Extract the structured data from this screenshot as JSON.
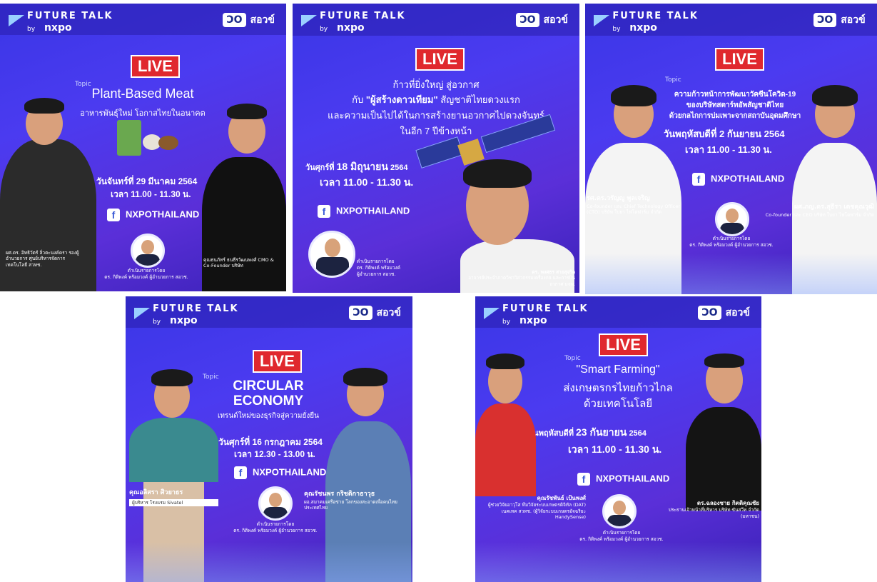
{
  "brand": {
    "future_talk": "FUTURE TALK",
    "by": "by",
    "nxpo": "nxpo",
    "logo_a": "ƆO",
    "logo_b": "สอวข์"
  },
  "colors": {
    "live_red": "#e0282e",
    "poster_blue": "#4b3bf0"
  },
  "posters": [
    {
      "live": "LIVE",
      "topic": "Topic",
      "title_en": "Plant-Based Meat",
      "title_th": "อาหารพันธุ์ใหม่ โอกาสไทยในอนาคต",
      "date": "วันจันทร์ที่ 29 มีนาคม 2564",
      "time": "เวลา 11.00 - 11.30 น.",
      "facebook": "NXPOTHAILAND",
      "host_line1": "ดำเนินรายการโดย",
      "host_line2": "ดร. กิติพงค์ พร้อมวงค์ ผู้อำนวยการ สอวช.",
      "guest_left": "ผศ.ดร. อิทธิวัตร์ ลิ่วตะนงค์ครา รองผู้อำนวยการ ศูนย์บริหารจัดการเทคโนโลยี สวทช.",
      "guest_right": "คุณธนภัทร์ ธนธีรวัฒนพงศ์ CMO & Co-Founder บริษัท"
    },
    {
      "live": "LIVE",
      "title_line1": "ก้าวที่ยิ่งใหญ่ สู่อวกาศ",
      "title_line2_a": "กับ",
      "title_line2_b": "\"ผู้สร้างดาวเทียม\"",
      "title_line2_c": "สัญชาติไทยดวงแรก",
      "title_line3": "และความเป็นไปได้ในการสร้างยานอวกาศไปดวงจันทร์",
      "title_line4": "ในอีก 7 ปีข้างหน้า",
      "date_a": "วันศุกร์ที่",
      "date_b": "18 มิถุนายน",
      "date_c": "2564",
      "time": "เวลา 11.00 - 11.30 น.",
      "facebook": "NXPOTHAILAND",
      "host_line1": "ดำเนินรายการโดย",
      "host_line2": "ดร. กิติพงค์ พร้อมวงค์",
      "host_line3": "ผู้อำนวยการ สอวช.",
      "guest_name": "ดร. พงศธร สายสุจริต",
      "guest_role": "อาจารย์ประจำภาควิชาวิศวกรรมเครื่องกล และการบินอวกาศ มจพ."
    },
    {
      "live": "LIVE",
      "topic": "Topic",
      "title_line1": "ความก้าวหน้าการพัฒนาวัคซีนโควิด-19",
      "title_line2": "ของบริษัทสตาร์ทอัพสัญชาติไทย",
      "title_line3": "ด้วยกลไกการบ่มเพาะจากสถาบันอุดมศึกษา",
      "date": "วันพฤหัสบดีที่ 2 กันยายน 2564",
      "time": "เวลา 11.00 - 11.30 น.",
      "facebook": "NXPOTHAILAND",
      "host_line1": "ดำเนินรายการโดย",
      "host_line2": "ดร. กิติพงค์ พร้อมวงค์ ผู้อำนวยการ สอวช.",
      "guest_left_name": "รศ.ดร.วรัญญู พูลเจริญ",
      "guest_left_role": "Co-founder และ Chief Technology Officer (CTO) บริษัท ใบยา ไฟโตฟาร์ม จำกัด",
      "guest_right_name": "ผศ.ภญ.ดร.สุธีรา เตชคุณวุฒิ",
      "guest_right_role": "Co-founder และ CEO บริษัท ใบยา ไฟโตฟาร์ม จำกัด"
    },
    {
      "live": "LIVE",
      "topic": "Topic",
      "title_en1": "CIRCULAR",
      "title_en2": "ECONOMY",
      "title_th": "เทรนด์ใหม่ของธุรกิจสู่ความยั่งยืน",
      "date": "วันศุกร์ที่ 16 กรกฎาคม 2564",
      "time": "เวลา 12.30 - 13.00 น.",
      "facebook": "NXPOTHAILAND",
      "host_line1": "ดำเนินรายการโดย",
      "host_line2": "ดร. กิติพงค์ พร้อมวงค์ ผู้อำนวยการ สอวช.",
      "guest_left_name": "คุณอลิสรา ศิวยาธร",
      "guest_left_role": "ผู้บริหาร โรงแรม Sivatel",
      "guest_right_name": "คุณรัชนพร กริชติกาธาวุธ",
      "guest_right_role": "ผอ.สมาคมเครือข่าย โลกของสะอาดเพื่อคนไทยประเทศไทย"
    },
    {
      "live": "LIVE",
      "topic": "Topic",
      "title_en": "\"Smart Farming\"",
      "title_th1": "ส่งเกษตรกรไทยก้าวไกล",
      "title_th2": "ด้วยเทคโนโลยี",
      "date_a": "วันพฤหัสบดีที่",
      "date_b": "23 กันยายน",
      "date_c": "2564",
      "time": "เวลา 11.00 - 11.30 น.",
      "facebook": "NXPOTHAILAND",
      "host_line1": "ดำเนินรายการโดย",
      "host_line2": "ดร. กิติพงค์ พร้อมวงค์ ผู้อำนวยการ สอวช.",
      "guest_left_name": "คุณรัชพันธ์ เป้นพงศ์",
      "guest_left_role": "ผู้ช่วยวิจัยอาวุโส ทีมวิจัยระบบเกษตรดิจิทัล (DAT) เนคเทค สวทช. (ผู้วิจัยระบบเกษตรอัจฉริยะ HandySense)",
      "guest_right_name": "ดร.ฉลองชาย กิตติคุณชัย",
      "guest_right_role": "ประธานเจ้าหน้าที่บริหาร บริษัท ซันสวีท จำกัด (มหาชน)"
    }
  ]
}
